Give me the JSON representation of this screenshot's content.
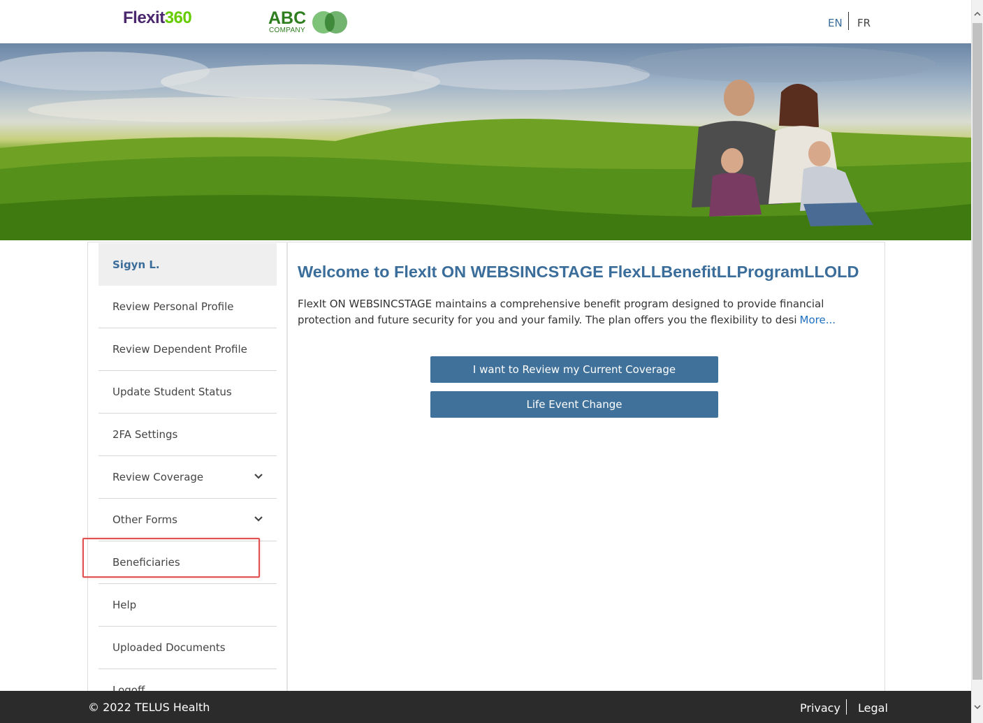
{
  "header": {
    "logo_flexit_part1": "Flexit",
    "logo_flexit_part2": "360",
    "logo_abc_main": "ABC",
    "logo_abc_sub": "COMPANY",
    "lang_en": "EN",
    "lang_fr": "FR"
  },
  "sidebar": {
    "user_name": "Sigyn L.",
    "items": [
      {
        "label": "Review Personal Profile"
      },
      {
        "label": "Review Dependent Profile"
      },
      {
        "label": "Update Student Status"
      },
      {
        "label": "2FA Settings"
      },
      {
        "label": "Review Coverage"
      },
      {
        "label": "Other Forms"
      },
      {
        "label": "Beneficiaries"
      },
      {
        "label": "Help"
      },
      {
        "label": "Uploaded Documents"
      },
      {
        "label": "Logoff"
      }
    ]
  },
  "main": {
    "welcome_title": "Welcome to FlexIt ON WEBSINCSTAGE FlexLLBenefitLLProgramLLOLD",
    "intro_text": "FlexIt ON WEBSINCSTAGE maintains a comprehensive benefit program designed to provide financial protection and future security for you and your family.  The plan offers you the flexibility to desi",
    "more_link": "More...",
    "btn_review_coverage": "I want to Review my Current Coverage",
    "btn_life_event": "Life Event Change"
  },
  "footer": {
    "copyright": "© 2022 TELUS Health",
    "privacy": "Privacy",
    "legal": "Legal"
  },
  "colors": {
    "accent_blue": "#3a6d9a",
    "button_blue": "#40719a",
    "footer_bg": "#2b2b2b",
    "highlight_red": "#e05050"
  }
}
